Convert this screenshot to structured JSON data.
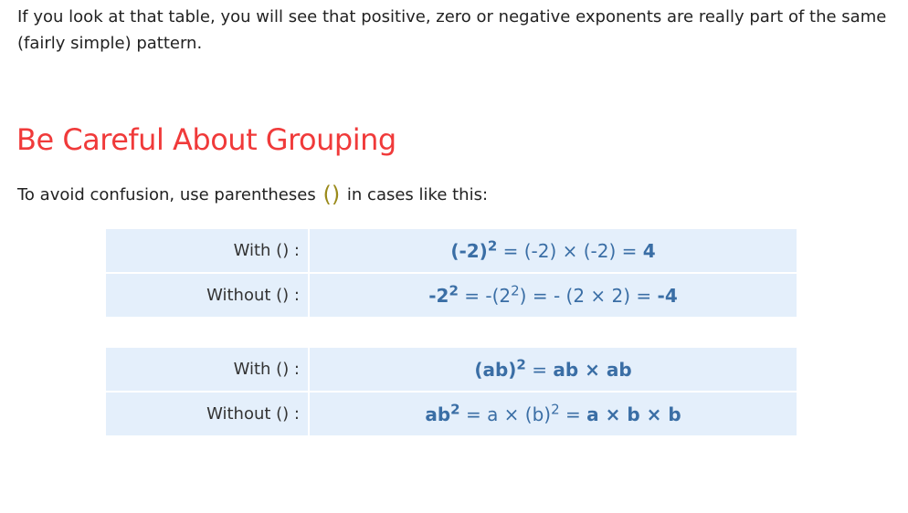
{
  "intro": {
    "text": "If you look at that table, you will see that positive, zero or negative exponents are really part of the same (fairly simple) pattern."
  },
  "heading": "Be Careful About Grouping",
  "note": {
    "before": "To avoid confusion, use parentheses",
    "parens": "()",
    "after": "in cases like this:"
  },
  "table1": {
    "rows": [
      {
        "label": "With () :",
        "base": "(-2)",
        "exp": "2",
        "rest": " = (-2) × (-2) = ",
        "result": "4"
      },
      {
        "label": "Without () :",
        "base": "-2",
        "exp": "2",
        "rest_a": " = -(2",
        "rest_exp": "2",
        "rest_b": ") = - (2 × 2) = ",
        "result": "-4"
      }
    ]
  },
  "table2": {
    "rows": [
      {
        "label": "With () :",
        "base": "(ab)",
        "exp": "2",
        "eq": " = ",
        "result": "ab × ab"
      },
      {
        "label": "Without () :",
        "base": "ab",
        "exp": "2",
        "rest_a": " = a × (b)",
        "rest_exp": "2",
        "eq": " = ",
        "result": "a × b × b"
      }
    ]
  }
}
